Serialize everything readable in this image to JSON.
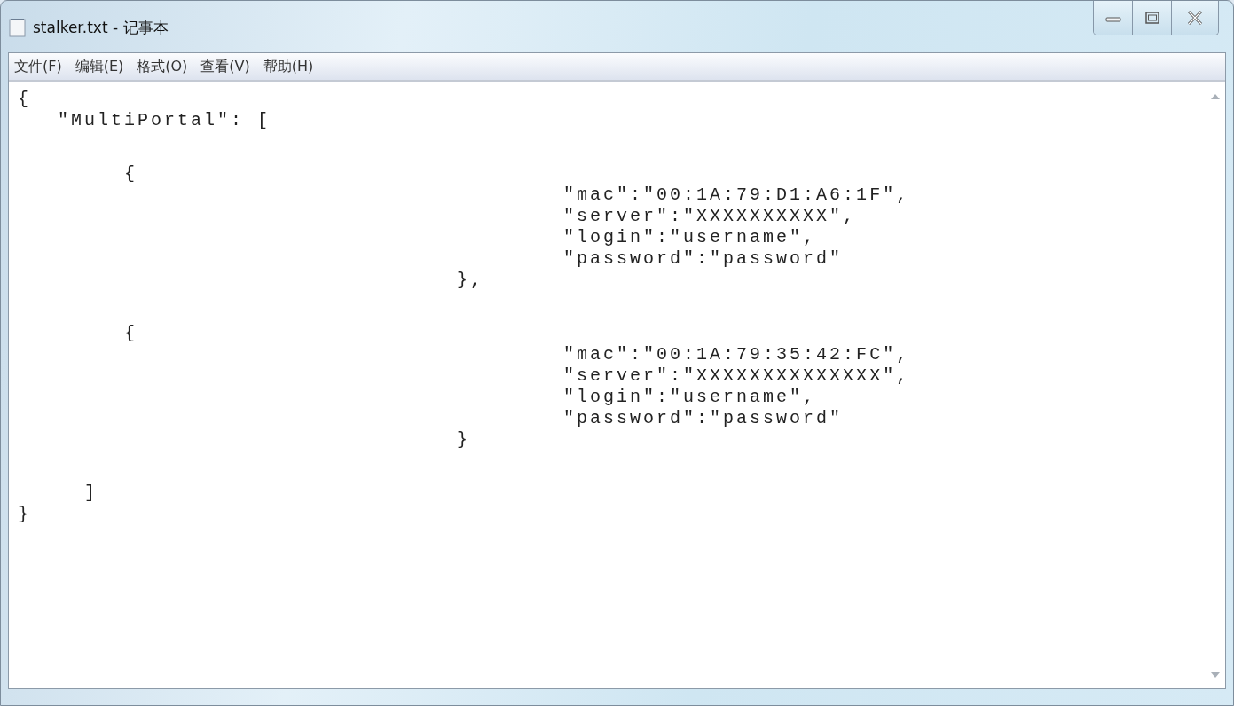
{
  "window": {
    "title": "stalker.txt - 记事本"
  },
  "menu": [
    "文件(F)",
    "编辑(E)",
    "格式(O)",
    "查看(V)",
    "帮助(H)"
  ],
  "document": {
    "blocks": [
      [
        "{",
        "   \"MultiPortal\": ["
      ],
      [
        "        {",
        "                                         \"mac\":\"00:1A:79:D1:A6:1F\",",
        "                                         \"server\":\"XXXXXXXXXX\",",
        "                                         \"login\":\"username\",",
        "                                         \"password\":\"password\"",
        "                                 },"
      ],
      [
        "        {",
        "                                         \"mac\":\"00:1A:79:35:42:FC\",",
        "                                         \"server\":\"XXXXXXXXXXXXXX\",",
        "                                         \"login\":\"username\",",
        "                                         \"password\":\"password\"",
        "                                 }"
      ],
      [
        "     ]",
        "}"
      ]
    ]
  }
}
